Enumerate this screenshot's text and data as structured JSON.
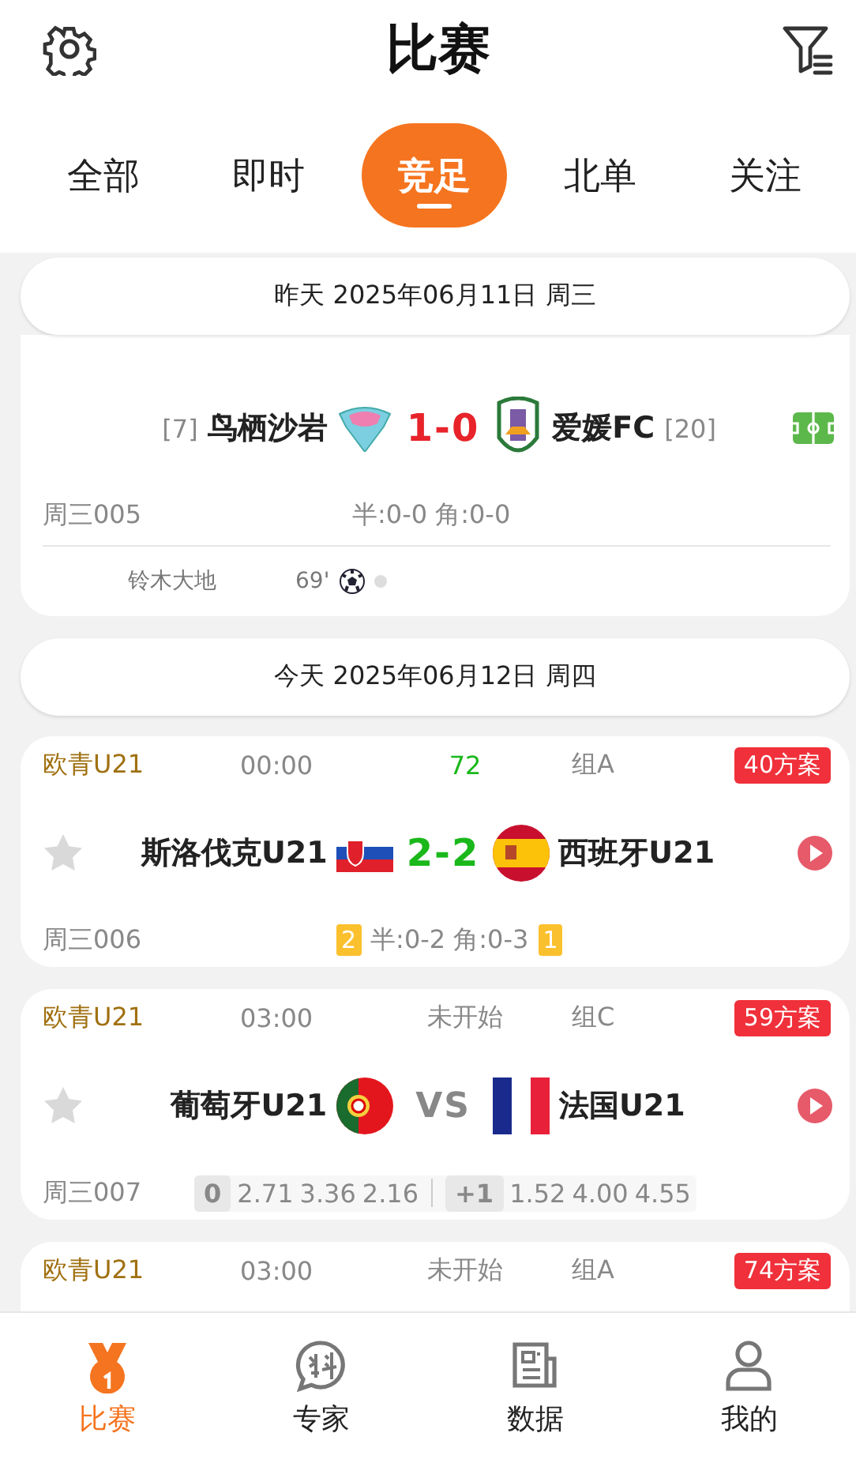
{
  "header": {
    "title": "比赛"
  },
  "tabs": [
    {
      "label": "全部",
      "selected": false
    },
    {
      "label": "即时",
      "selected": false
    },
    {
      "label": "竞足",
      "selected": true
    },
    {
      "label": "北单",
      "selected": false
    },
    {
      "label": "关注",
      "selected": false
    }
  ],
  "sections": [
    {
      "date": "昨天 2025年06月11日 周三",
      "matches": [
        {
          "kind": "result",
          "home": {
            "name": "鸟栖沙岩",
            "rank": "[7]"
          },
          "away": {
            "name": "爱媛FC",
            "rank": "[20]"
          },
          "score": {
            "kind": "score",
            "text": "1-0",
            "color": "#e8232a"
          },
          "footer": {
            "kind": "stats",
            "code": "周三005",
            "stats": "半:0-0 角:0-0"
          },
          "event": {
            "player": "铃木大地",
            "minute": "69'"
          }
        }
      ]
    },
    {
      "date": "今天 2025年06月12日 周四",
      "matches": [
        {
          "kind": "fixture",
          "league": "欧青U21",
          "time": "00:00",
          "status": "72",
          "live": true,
          "round": "组A",
          "plans": "40方案",
          "starred": false,
          "home": {
            "name": "斯洛伐克U21"
          },
          "away": {
            "name": "西班牙U21"
          },
          "score": {
            "kind": "score",
            "text": "2-2",
            "color": "#1ab81a"
          },
          "footer": {
            "kind": "stats",
            "code": "周三006",
            "home_cards": "2",
            "stats": "半:0-2 角:0-3",
            "away_cards": "1"
          }
        },
        {
          "kind": "fixture",
          "league": "欧青U21",
          "time": "03:00",
          "status": "未开始",
          "live": false,
          "round": "组C",
          "plans": "59方案",
          "starred": false,
          "home": {
            "name": "葡萄牙U21"
          },
          "away": {
            "name": "法国U21"
          },
          "score": {
            "kind": "vs",
            "text": "VS",
            "color": "#888888"
          },
          "footer": {
            "kind": "odds",
            "code": "周三007",
            "handicap_1": "0",
            "odds_1": [
              "2.71",
              "3.36",
              "2.16"
            ],
            "handicap_2": "+1",
            "odds_2": [
              "1.52",
              "4.00",
              "4.55"
            ]
          }
        },
        {
          "league": "欧青U21",
          "time": "03:00",
          "status": "未开始",
          "live": false,
          "round": "组A",
          "plans": "74方案"
        }
      ]
    }
  ],
  "bottom_nav": [
    {
      "label": "比赛",
      "selected": true
    },
    {
      "label": "专家",
      "selected": false
    },
    {
      "label": "数据",
      "selected": false
    },
    {
      "label": "我的",
      "selected": false
    }
  ]
}
